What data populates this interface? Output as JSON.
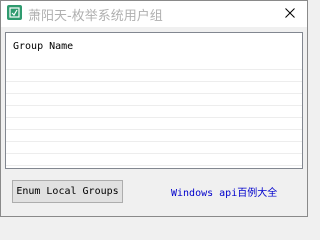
{
  "window": {
    "title": "萧阳天-枚举系统用户组",
    "icon": "app-icon",
    "close_icon": "close-icon"
  },
  "list": {
    "column_header": "Group Name",
    "rows": []
  },
  "actions": {
    "enum_button_label": "Enum Local Groups",
    "link_text": "Windows api百例大全"
  },
  "colors": {
    "link": "#0000cc",
    "app_icon": "#2f9b6f"
  }
}
